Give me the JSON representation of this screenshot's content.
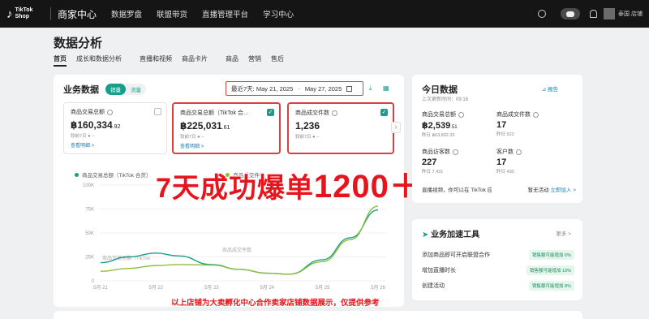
{
  "topbar": {
    "logo_line1": "TikTok",
    "logo_line2": "Shop",
    "portal": "商家中心",
    "nav": [
      "数据罗盘",
      "联盟带货",
      "直播管理平台",
      "学习中心"
    ],
    "store": "泰国 店铺"
  },
  "page": {
    "title": "数据分析",
    "tabs": [
      "首页",
      "成长和数据分析",
      "直播和视频",
      "商品卡片",
      "商品",
      "营销",
      "售后"
    ]
  },
  "business": {
    "title": "业务数据",
    "toggle": [
      "销量",
      "流量"
    ],
    "date_prefix": "最近7天:",
    "date_start": "May 21, 2025",
    "date_sep": "-",
    "date_end": "May 27, 2025",
    "metrics": [
      {
        "label": "商品交易总额",
        "value": "฿160,334",
        "dec": ".92",
        "sub": "较前7日 ● --",
        "link": "查看明细 >"
      },
      {
        "label": "商品交易总额（TikTok 合…",
        "value": "฿225,031",
        "dec": ".61",
        "sub": "较前7日 ● --",
        "link": "查看明细 >"
      },
      {
        "label": "商品成交件数",
        "value": "1,236",
        "dec": "",
        "sub": "较前7日 ● --",
        "link": ""
      }
    ]
  },
  "chart_data": {
    "type": "line",
    "x": [
      "5月 21",
      "5月 22",
      "5月 23",
      "5月 24",
      "5月 25",
      "5月 26"
    ],
    "ylabels": [
      "100K",
      "75K",
      "50K",
      "25K",
      "0"
    ],
    "ylim": [
      0,
      100000
    ],
    "series": [
      {
        "name": "商品交易总额（TikTok 合货）",
        "color": "#1a9e8b",
        "points": [
          [
            0,
            19000
          ],
          [
            0.5,
            25000
          ],
          [
            1,
            29000
          ],
          [
            1.4,
            26000
          ],
          [
            2,
            17000
          ],
          [
            2.5,
            12000
          ],
          [
            3,
            8000
          ],
          [
            3.4,
            7000
          ],
          [
            4,
            22000
          ],
          [
            4.5,
            45000
          ],
          [
            5,
            74000
          ]
        ]
      },
      {
        "name": "商品成交件数",
        "color": "#8fbf3a",
        "points": [
          [
            0,
            10000
          ],
          [
            0.5,
            13000
          ],
          [
            1,
            16000
          ],
          [
            1.4,
            17000
          ],
          [
            2,
            16500
          ],
          [
            2.5,
            12000
          ],
          [
            3,
            8000
          ],
          [
            3.4,
            7000
          ],
          [
            4,
            20000
          ],
          [
            4.5,
            43000
          ],
          [
            5,
            78000
          ]
        ]
      }
    ],
    "legend": [
      "商品交易总额（TikTok 合货）",
      "商品成交件数"
    ],
    "annotation_1": "商品交易总额（TikTok",
    "annotation_2": "商品成交件数"
  },
  "overlay": {
    "promo": "7天成功爆单",
    "promo_num": "1200＋",
    "caption": "以上店铺为大卖孵化中心合作卖家店铺数据展示，仅提供参考"
  },
  "today": {
    "title": "今日数据",
    "updated": "上次更新时间：09:18",
    "report": "报告",
    "cells": [
      {
        "label": "商品交易总额",
        "value": "฿2,539",
        "dec": ".51",
        "sub": "昨日 ฿63,802.33"
      },
      {
        "label": "商品成交件数",
        "value": "17",
        "dec": "",
        "sub": "昨日 522"
      },
      {
        "label": "商品访客数",
        "value": "227",
        "dec": "",
        "sub": "昨日 7,431"
      },
      {
        "label": "客户数",
        "value": "17",
        "dec": "",
        "sub": "昨日 430"
      }
    ],
    "live_text": "直播视频，你可以在 TikTok 应用中创建直播...",
    "live_status": "暂无活动",
    "live_join": "立即加入 >"
  },
  "tools": {
    "title": "业务加速工具",
    "more": "更多 >",
    "rows": [
      {
        "label": "添加商品即可开启联盟合作",
        "badge": "销售额可能增加 6%"
      },
      {
        "label": "增加直播时长",
        "badge": "销售额可能增加 13%"
      },
      {
        "label": "创建活动",
        "badge": "销售额可能增加 8%"
      }
    ]
  }
}
